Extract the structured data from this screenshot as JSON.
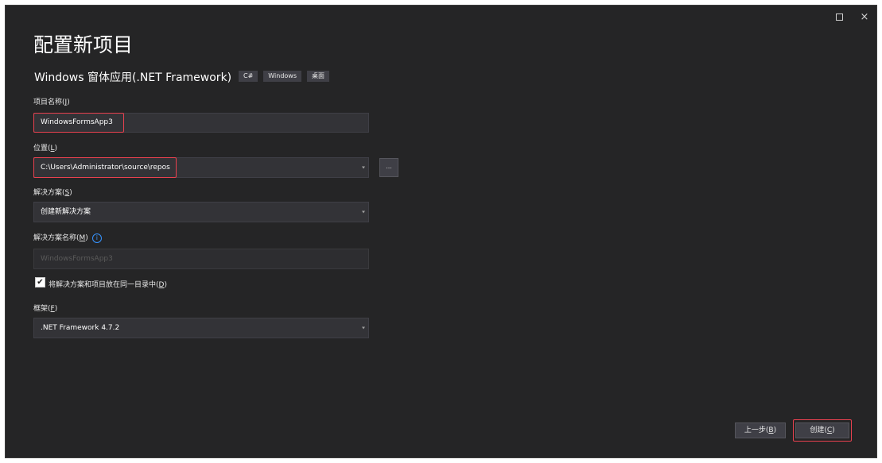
{
  "window": {
    "maximize_icon": "maximize-icon",
    "close_symbol": "×"
  },
  "header": {
    "title": "配置新项目",
    "subtitle": "Windows 窗体应用(.NET Framework)",
    "tags": [
      "C#",
      "Windows",
      "桌面"
    ]
  },
  "form": {
    "project_name": {
      "label": "项目名称",
      "hotkey": "J",
      "value": "WindowsFormsApp3"
    },
    "location": {
      "label": "位置",
      "hotkey": "L",
      "value": "C:\\Users\\Administrator\\source\\repos",
      "browse_label": "..."
    },
    "solution": {
      "label": "解决方案",
      "hotkey": "S",
      "value": "创建新解决方案"
    },
    "solution_name": {
      "label": "解决方案名称",
      "hotkey": "M",
      "placeholder": "WindowsFormsApp3"
    },
    "same_dir": {
      "label": "将解决方案和项目放在同一目录中",
      "hotkey": "D",
      "checked": true,
      "check_symbol": "✔"
    },
    "framework": {
      "label": "框架",
      "hotkey": "F",
      "value": ".NET Framework 4.7.2"
    }
  },
  "footer": {
    "back_label": "上一步",
    "back_hotkey": "B",
    "create_label": "创建",
    "create_hotkey": "C"
  },
  "colors": {
    "highlight": "#e8414f",
    "info": "#3794ff",
    "window_bg": "#252526"
  }
}
